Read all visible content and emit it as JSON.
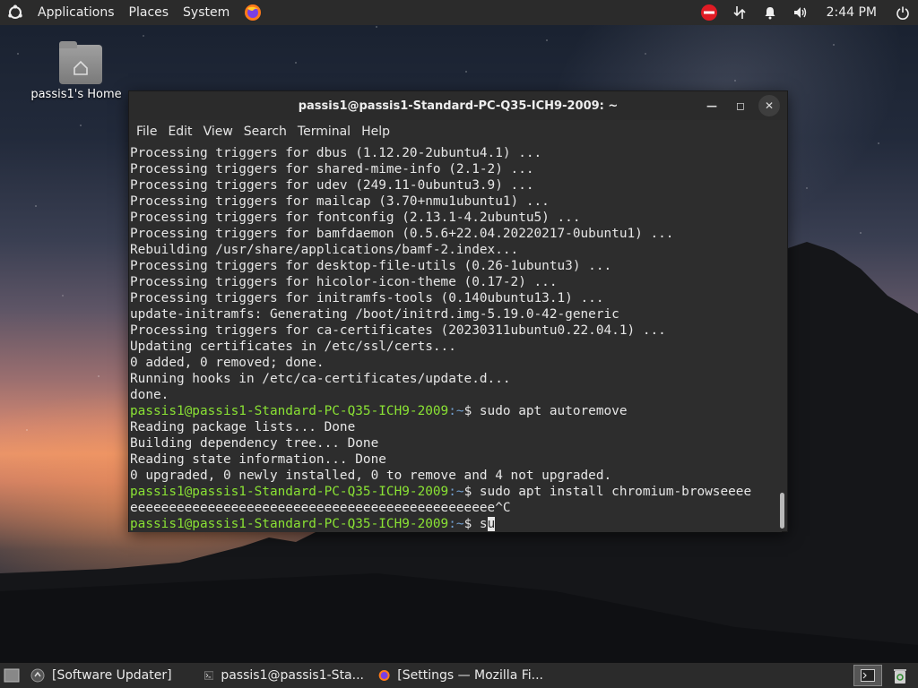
{
  "top_panel": {
    "menus": [
      "Applications",
      "Places",
      "System"
    ],
    "clock": "2:44 PM",
    "icons": [
      "ubuntu-logo-icon",
      "firefox-icon",
      "do-not-disturb-icon",
      "network-icon",
      "bell-icon",
      "volume-icon",
      "power-icon"
    ]
  },
  "desktop": {
    "home_icon_label": "passis1's Home"
  },
  "terminal": {
    "title": "passis1@passis1-Standard-PC-Q35-ICH9-2009: ~",
    "menus": [
      "File",
      "Edit",
      "View",
      "Search",
      "Terminal",
      "Help"
    ],
    "lines": [
      {
        "text": "Processing triggers for dbus (1.12.20-2ubuntu4.1) ..."
      },
      {
        "text": "Processing triggers for shared-mime-info (2.1-2) ..."
      },
      {
        "text": "Processing triggers for udev (249.11-0ubuntu3.9) ..."
      },
      {
        "text": "Processing triggers for mailcap (3.70+nmu1ubuntu1) ..."
      },
      {
        "text": "Processing triggers for fontconfig (2.13.1-4.2ubuntu5) ..."
      },
      {
        "text": "Processing triggers for bamfdaemon (0.5.6+22.04.20220217-0ubuntu1) ..."
      },
      {
        "text": "Rebuilding /usr/share/applications/bamf-2.index..."
      },
      {
        "text": "Processing triggers for desktop-file-utils (0.26-1ubuntu3) ..."
      },
      {
        "text": "Processing triggers for hicolor-icon-theme (0.17-2) ..."
      },
      {
        "text": "Processing triggers for initramfs-tools (0.140ubuntu13.1) ..."
      },
      {
        "text": "update-initramfs: Generating /boot/initrd.img-5.19.0-42-generic"
      },
      {
        "text": "Processing triggers for ca-certificates (20230311ubuntu0.22.04.1) ..."
      },
      {
        "text": "Updating certificates in /etc/ssl/certs..."
      },
      {
        "text": "0 added, 0 removed; done."
      },
      {
        "text": "Running hooks in /etc/ca-certificates/update.d..."
      },
      {
        "text": "done."
      },
      {
        "prompt_user": "passis1@passis1-Standard-PC-Q35-ICH9-2009",
        "prompt_path": ":~",
        "text": "$ sudo apt autoremove"
      },
      {
        "text": "Reading package lists... Done"
      },
      {
        "text": "Building dependency tree... Done"
      },
      {
        "text": "Reading state information... Done"
      },
      {
        "text": "0 upgraded, 0 newly installed, 0 to remove and 4 not upgraded."
      },
      {
        "prompt_user": "passis1@passis1-Standard-PC-Q35-ICH9-2009",
        "prompt_path": ":~",
        "text": "$ sudo apt install chromium-browseeee"
      },
      {
        "text": "eeeeeeeeeeeeeeeeeeeeeeeeeeeeeeeeeeeeeeeeeeeeeee^C"
      },
      {
        "prompt_user": "passis1@passis1-Standard-PC-Q35-ICH9-2009",
        "prompt_path": ":~",
        "text": "$ s",
        "cursor": "u"
      }
    ]
  },
  "taskbar": {
    "tasks": [
      {
        "label": "[Software Updater]",
        "icon": "software-updater-icon"
      },
      {
        "label": "passis1@passis1-Sta...",
        "icon": "terminal-icon"
      },
      {
        "label": "[Settings — Mozilla Fi...",
        "icon": "firefox-icon"
      }
    ]
  },
  "colors": {
    "panel": "#2b2b2b",
    "terminal_bg": "#2d2d2d",
    "prompt_user": "#8ae234",
    "prompt_path": "#729fcf"
  }
}
